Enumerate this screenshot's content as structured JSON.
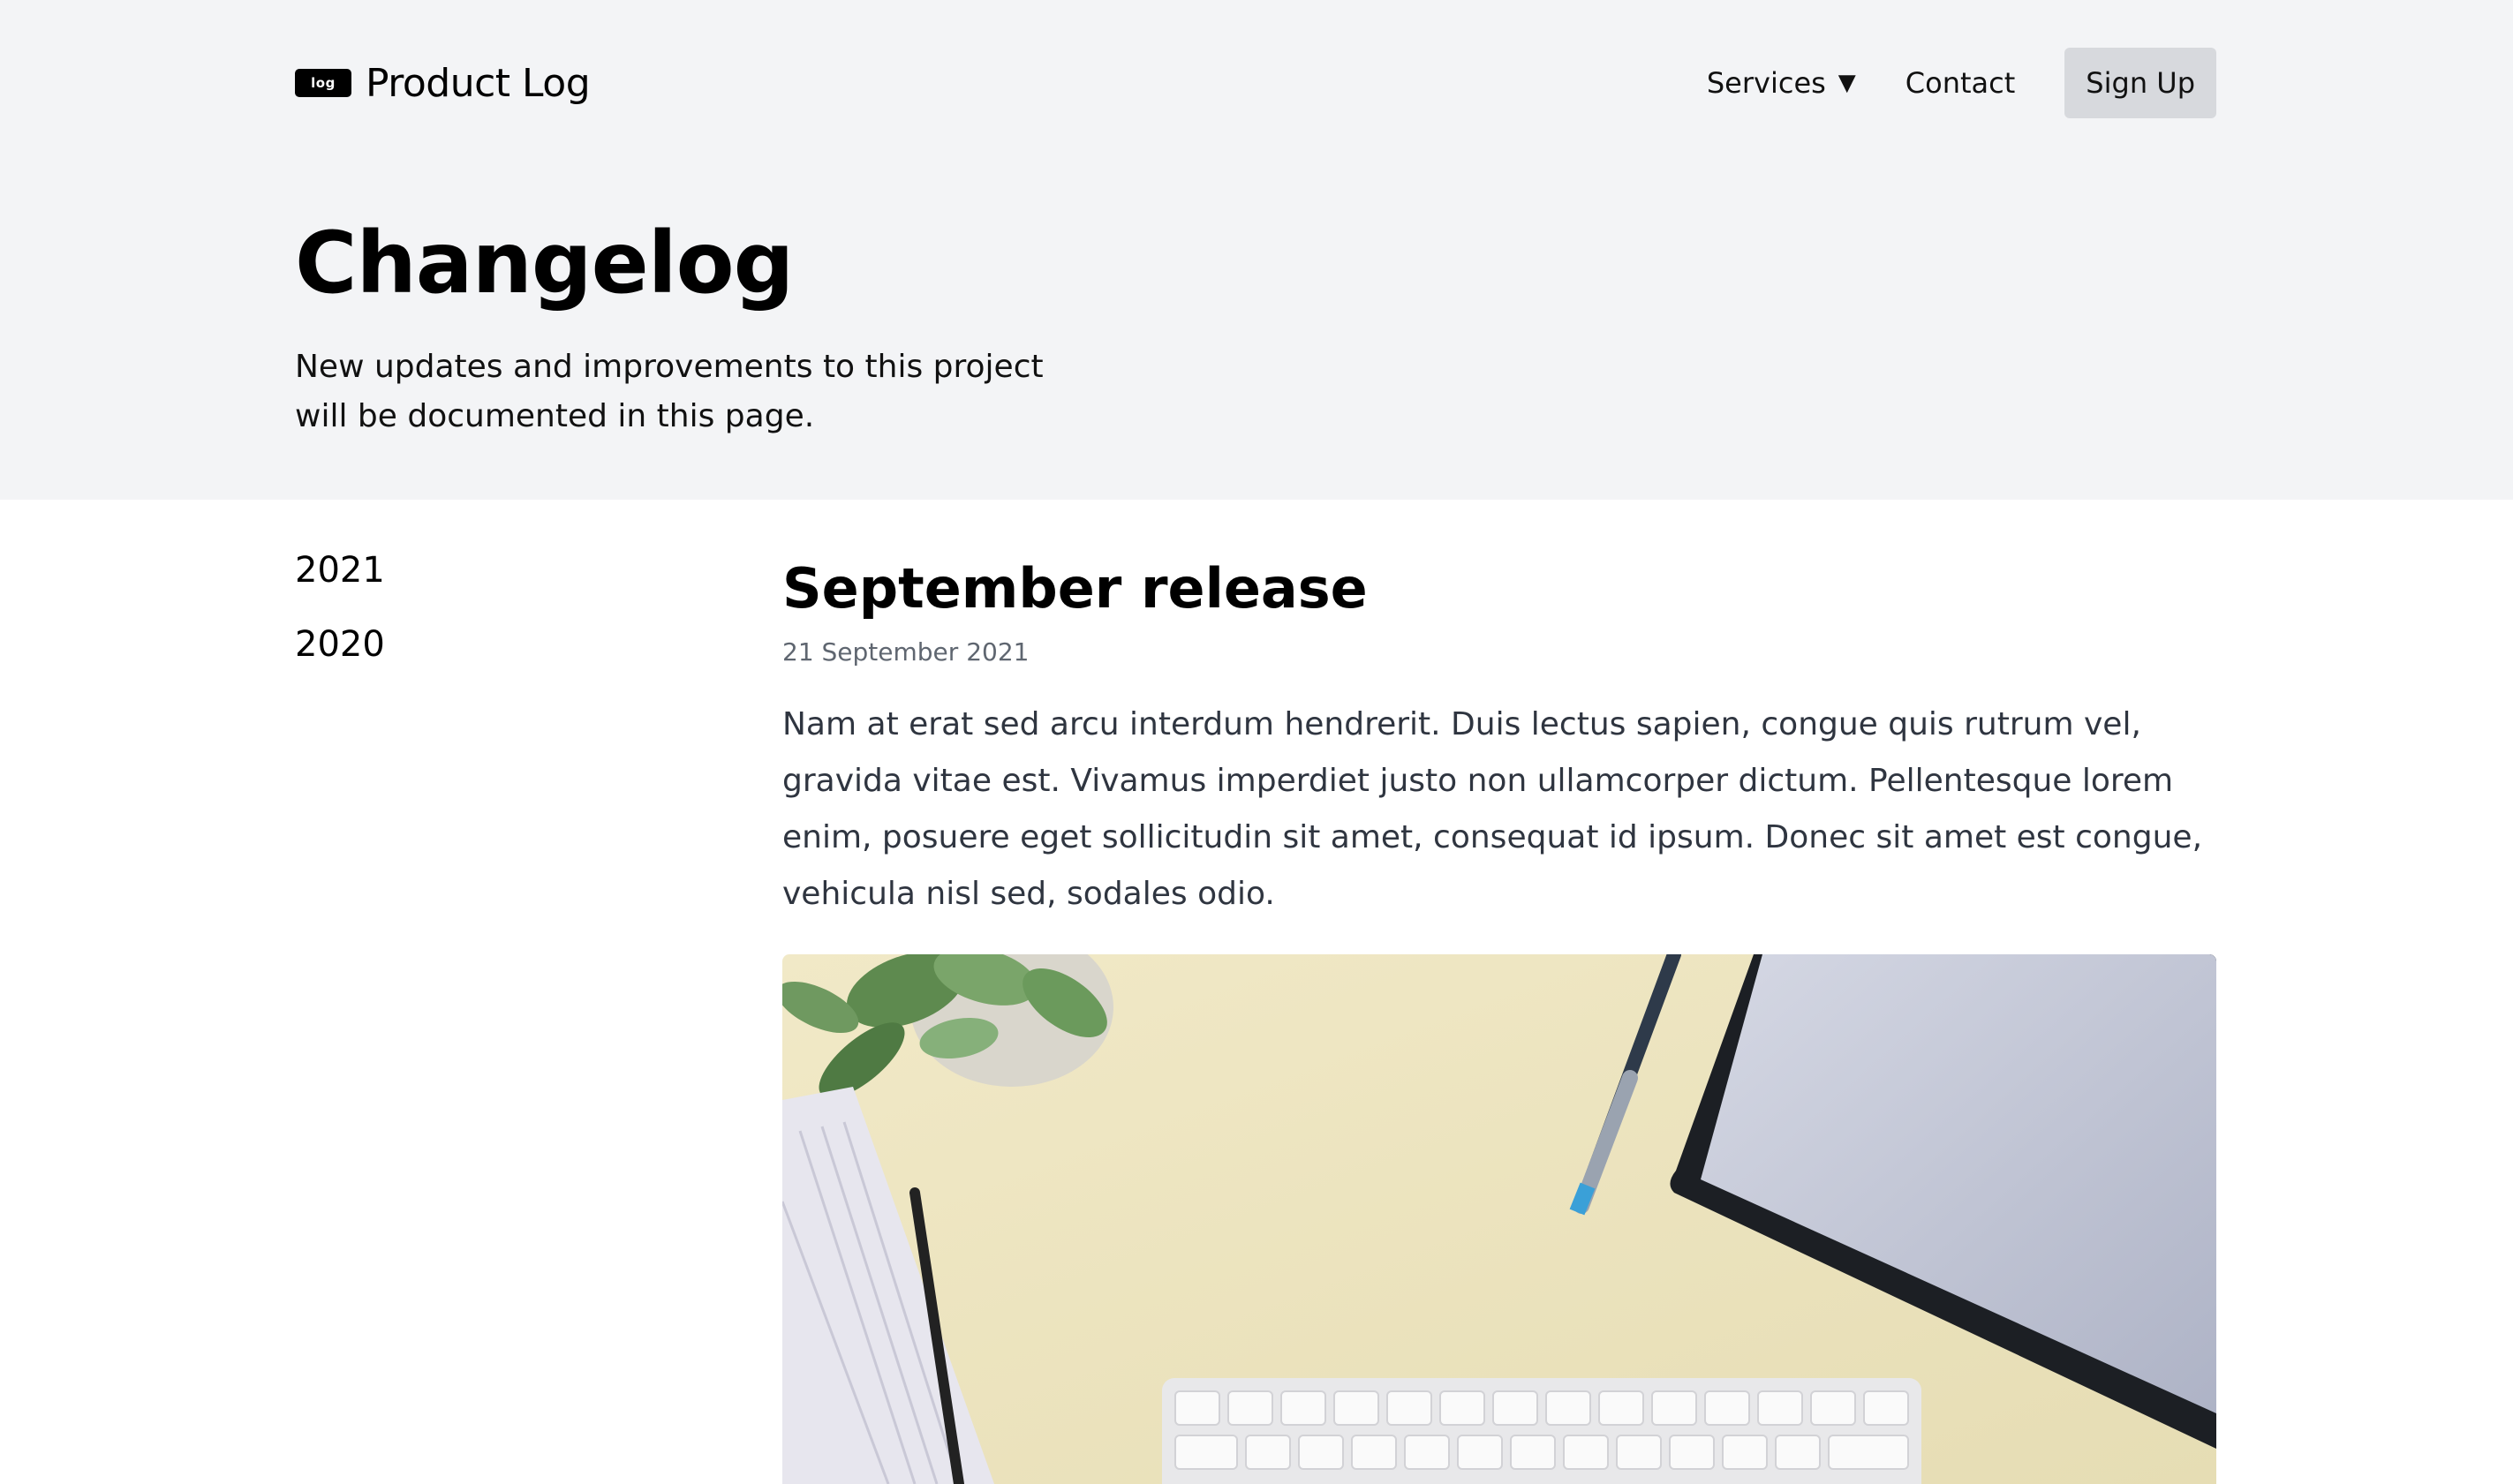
{
  "brand": {
    "logo_text": "log",
    "name": "Product Log"
  },
  "nav": {
    "services_label": "Services",
    "services_caret": "▼",
    "contact_label": "Contact",
    "signup_label": "Sign Up"
  },
  "hero": {
    "title": "Changelog",
    "subtitle": "New updates and improvements to this project will be documented in this page."
  },
  "sidebar": {
    "years": [
      "2021",
      "2020"
    ]
  },
  "release": {
    "title": "September release",
    "date": "21 September 2021",
    "body": "Nam at erat sed arcu interdum hendrerit. Duis lectus sapien, congue quis rutrum vel, gravida vitae est. Vivamus imperdiet justo non ullamcorper dictum. Pellentesque lorem enim, posuere eget sollicitudin sit amet, consequat id ipsum. Donec sit amet est congue, vehicula nisl sed, sodales odio."
  },
  "colors": {
    "header_bg": "#f3f4f6",
    "signup_bg": "#d7d9dd",
    "desk": "#eee6c2",
    "tablet_frame": "#1c1f24",
    "tablet_screen": "#c3c7d6"
  }
}
